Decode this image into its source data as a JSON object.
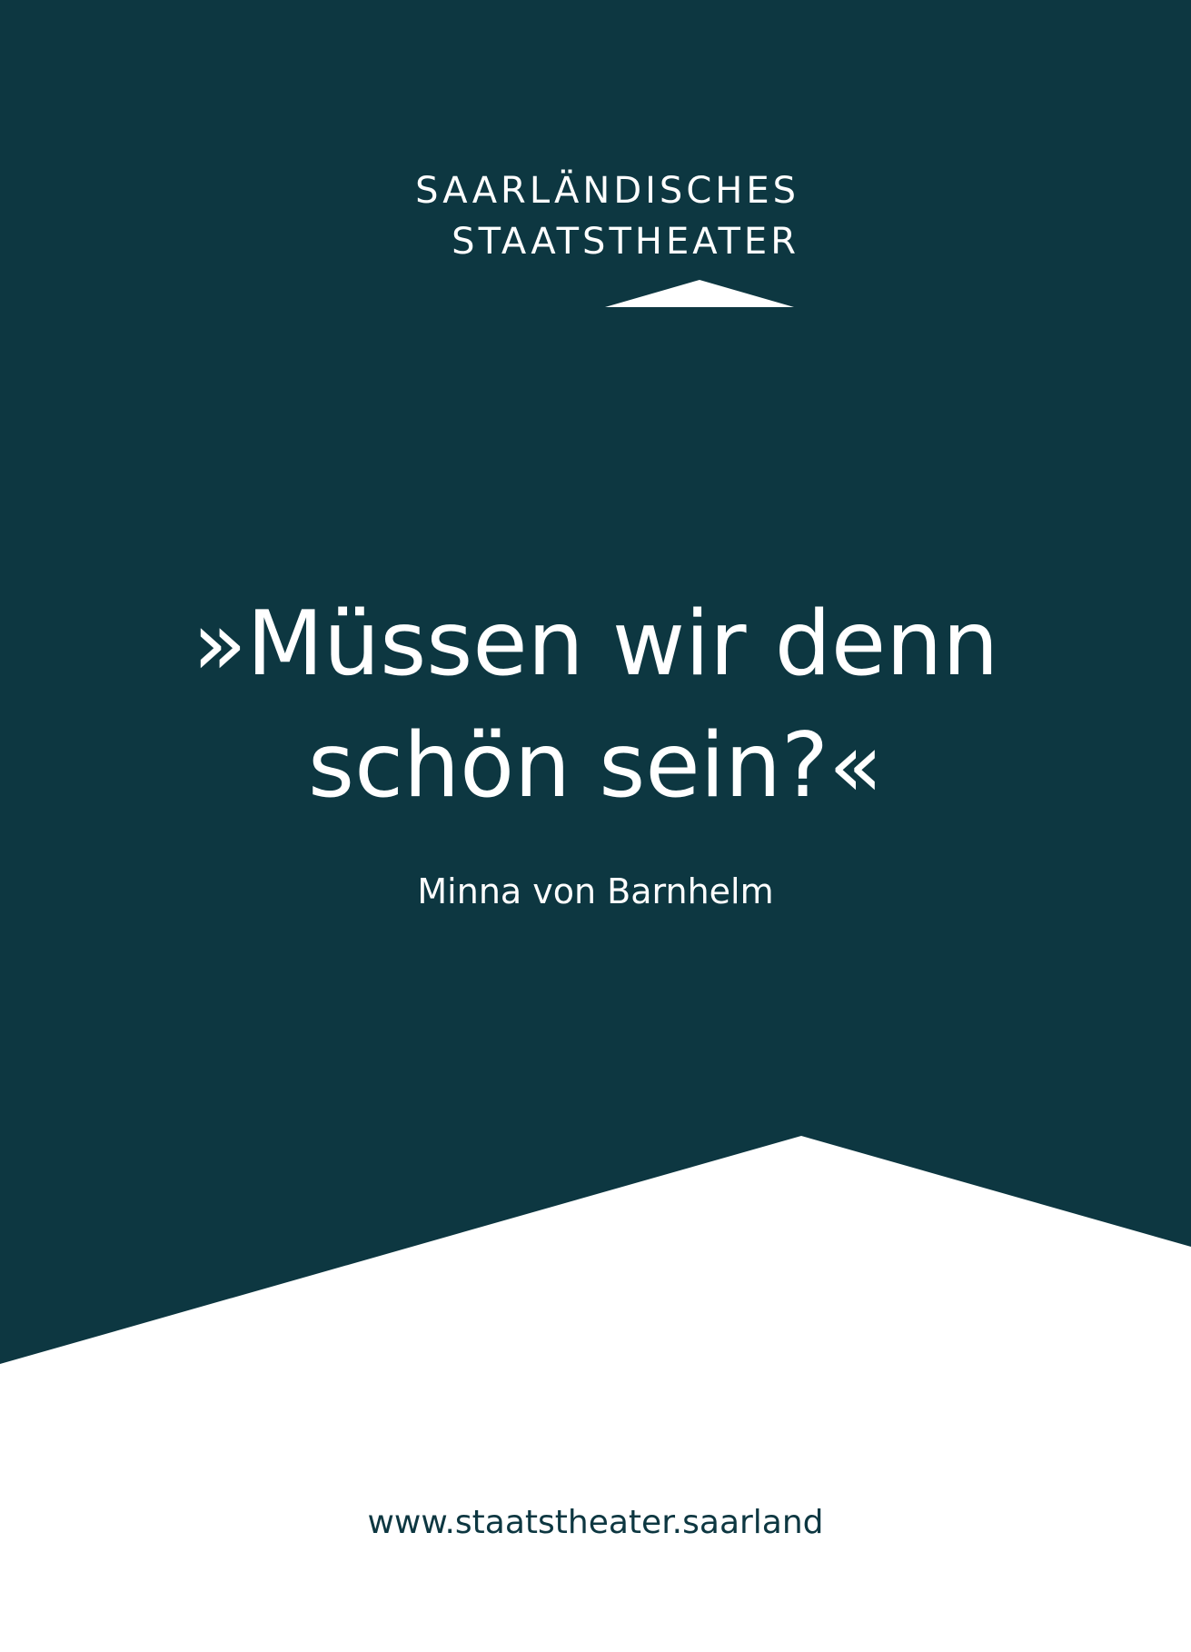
{
  "logo": {
    "line1": "SAARLÄNDISCHES",
    "line2": "STAATSTHEATER"
  },
  "quote": {
    "line1": "»Müssen wir denn",
    "line2": "schön sein?«"
  },
  "attribution": "Minna von Barnhelm",
  "footer": {
    "url": "www.staatstheater.saarland"
  },
  "colors": {
    "primary": "#0d3741",
    "background": "#ffffff",
    "text_on_primary": "#ffffff"
  }
}
